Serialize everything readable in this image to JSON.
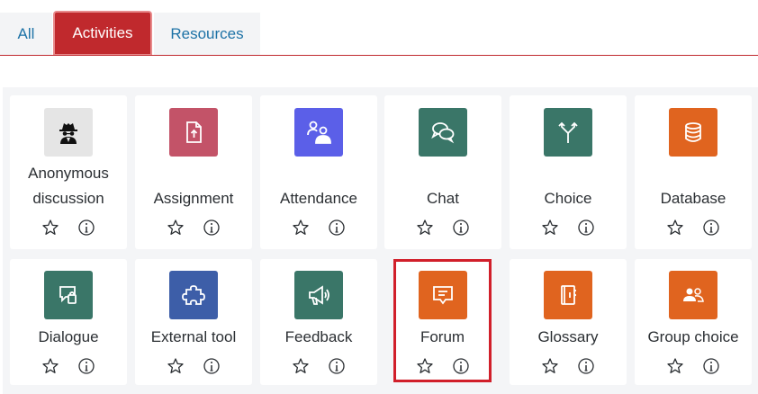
{
  "tabs": [
    {
      "label": "All",
      "active": false
    },
    {
      "label": "Activities",
      "active": true
    },
    {
      "label": "Resources",
      "active": false
    }
  ],
  "activities": [
    {
      "label_line1": "Anonymous",
      "label_line2": "discussion",
      "icon": "spy-icon",
      "color": "#e5e5e5"
    },
    {
      "label": "Assignment",
      "icon": "assignment-upload-icon",
      "color": "#c35368"
    },
    {
      "label": "Attendance",
      "icon": "attendance-people-icon",
      "color": "#5b5fe8"
    },
    {
      "label": "Chat",
      "icon": "chat-bubbles-icon",
      "color": "#3a7668"
    },
    {
      "label": "Choice",
      "icon": "choice-arrows-icon",
      "color": "#3a7668"
    },
    {
      "label": "Database",
      "icon": "database-icon",
      "color": "#e0641f"
    },
    {
      "label": "Dialogue",
      "icon": "dialogue-icon",
      "color": "#3a7668"
    },
    {
      "label": "External tool",
      "icon": "puzzle-icon",
      "color": "#3d5ea8"
    },
    {
      "label": "Feedback",
      "icon": "megaphone-icon",
      "color": "#3a7668"
    },
    {
      "label": "Forum",
      "icon": "forum-icon",
      "color": "#e0641f"
    },
    {
      "label": "Glossary",
      "icon": "glossary-book-icon",
      "color": "#e0641f"
    },
    {
      "label": "Group choice",
      "icon": "group-choice-icon",
      "color": "#e0641f"
    }
  ],
  "highlighted_item": "Forum"
}
